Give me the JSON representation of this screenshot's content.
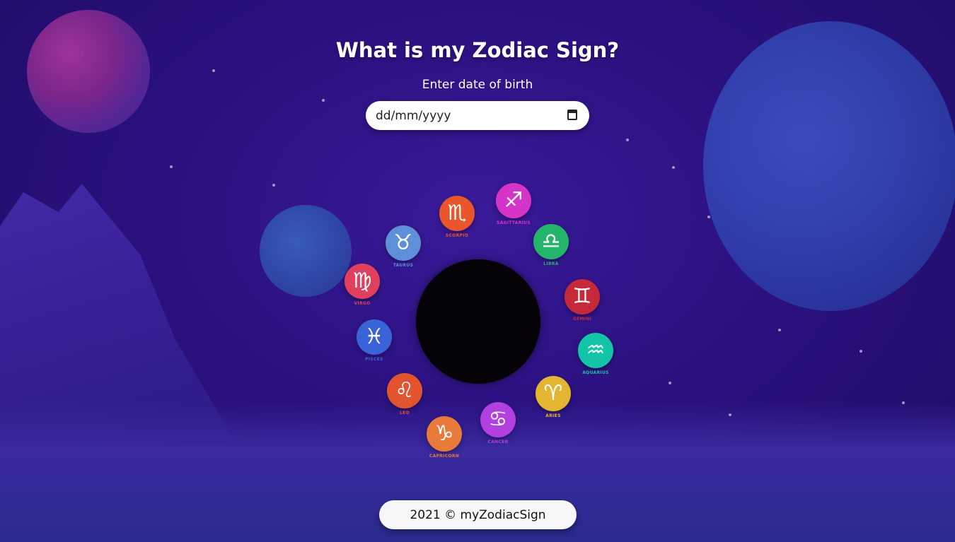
{
  "page": {
    "title": "What is my Zodiac Sign?",
    "dob_label": "Enter date of birth",
    "date_placeholder": "dd/mm/yyyy",
    "footer": "2021 © myZodiacSign"
  },
  "zodiac_signs": [
    {
      "name": "SCORPIO",
      "icon": "scorpion-icon",
      "symbol": "♏",
      "color": "#e8562a"
    },
    {
      "name": "SAGITTARIUS",
      "icon": "archer-bow-icon",
      "symbol": "♐",
      "color": "#d534c8"
    },
    {
      "name": "LIBRA",
      "icon": "scales-icon",
      "symbol": "♎",
      "color": "#23b56a"
    },
    {
      "name": "GEMINI",
      "icon": "twins-icon",
      "symbol": "♊",
      "color": "#c62a3a"
    },
    {
      "name": "AQUARIUS",
      "icon": "water-bearer-icon",
      "symbol": "♒",
      "color": "#14c4a6"
    },
    {
      "name": "ARIES",
      "icon": "ram-icon",
      "symbol": "♈",
      "color": "#e3b530"
    },
    {
      "name": "CANCER",
      "icon": "crab-icon",
      "symbol": "♋",
      "color": "#b23fe0"
    },
    {
      "name": "CAPRICORN",
      "icon": "goat-icon",
      "symbol": "♑",
      "color": "#e87a3a"
    },
    {
      "name": "LEO",
      "icon": "lion-icon",
      "symbol": "♌",
      "color": "#e2542f"
    },
    {
      "name": "PISCES",
      "icon": "fish-icon",
      "symbol": "♓",
      "color": "#3a63d8"
    },
    {
      "name": "VIRGO",
      "icon": "maiden-icon",
      "symbol": "♍",
      "color": "#e0405e"
    },
    {
      "name": "TAURUS",
      "icon": "bull-icon",
      "symbol": "♉",
      "color": "#5f8fd8"
    }
  ]
}
